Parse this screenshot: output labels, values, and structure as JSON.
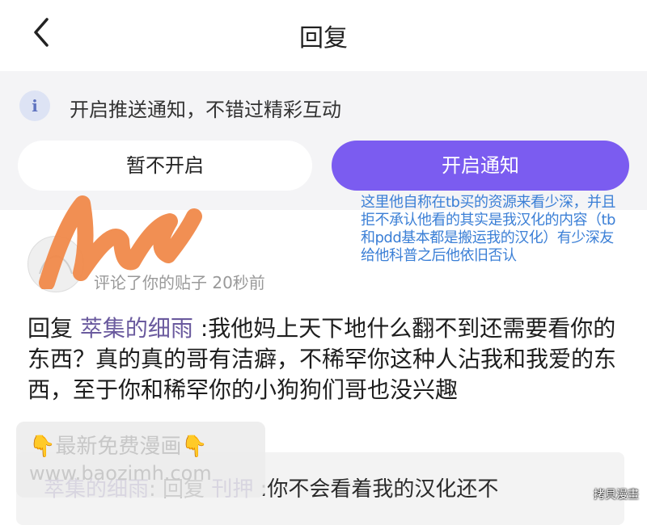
{
  "header": {
    "title": "回复"
  },
  "push": {
    "info_icon": "info-icon",
    "text": "开启推送通知，不错过精彩互动",
    "skip_label": "暂不开启",
    "enable_label": "开启通知",
    "accent": "#7b5cf0"
  },
  "annotation": {
    "text": "这里他自称在tb买的资源来看少深，并且拒不承认他看的其实是我汉化的内容（tb和pdd基本都是搬运我的汉化）有少深友给他科普之后他依旧否认"
  },
  "comment": {
    "meta": "评论了你的贴子  20秒前",
    "prefix": "回复",
    "target_user": "萃集的细雨",
    "text": " :我他妈上天下地什么翻不到还需要看你的东西？真的真的哥有洁癖，不稀罕你这种人沾我和我爱的东西，至于你和稀罕你的小狗狗们哥也没兴趣"
  },
  "watermark": {
    "line1": "最新免费漫画",
    "line2": "www.baozimh.com",
    "hand": "👇"
  },
  "quote": {
    "user": "萃集的细雨",
    "sep": ": 回复 ",
    "target": "刊押",
    "text": " :你不会看着我的汉化还不"
  },
  "corner": "拷貝漫畫"
}
